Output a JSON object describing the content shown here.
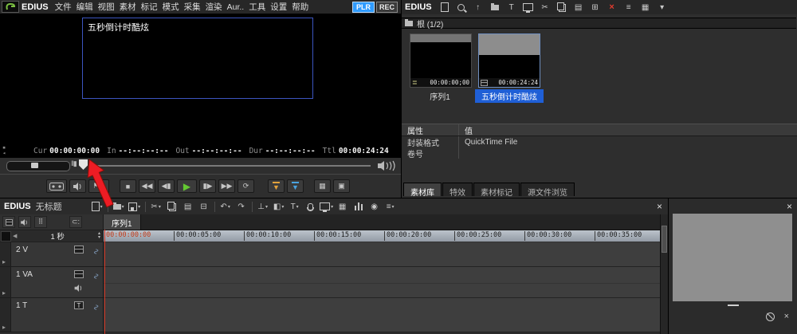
{
  "colors": {
    "selection_blue": "#1f5fd6",
    "plr_blue": "#2f9bff",
    "play_green": "#64c832",
    "red_x": "#e23b2e",
    "annotation_red": "#ed1c24",
    "ruler_bg": "#a8b0ba",
    "playhead_red": "#d0301d"
  },
  "preview": {
    "brand": "EDIUS",
    "menu": [
      "文件",
      "编辑",
      "视图",
      "素材",
      "标记",
      "模式",
      "采集",
      "渲染",
      "Aur..",
      "工具",
      "设置",
      "帮助"
    ],
    "plr_label": "PLR",
    "rec_label": "REC",
    "overlay_text": "五秒倒计时酷炫",
    "timecode": {
      "cur_label": "Cur",
      "cur_value": "00:00:00:00",
      "in_label": "In",
      "in_value": "--:--:--:--",
      "out_label": "Out",
      "out_value": "--:--:--:--",
      "dur_label": "Dur",
      "dur_value": "--:--:--:--",
      "ttl_label": "Ttl",
      "ttl_value": "00:00:24:24"
    }
  },
  "bin": {
    "brand": "EDIUS",
    "path_label": "根 (1/2)",
    "clips": [
      {
        "name": "序列1",
        "timecode": "00:00:00;00"
      },
      {
        "name": "五秒倒计时酷炫",
        "timecode": "00:00:24:24"
      }
    ],
    "properties": {
      "header_attr": "属性",
      "header_value": "值",
      "rows": [
        {
          "attr": "封装格式",
          "value": "QuickTime File"
        },
        {
          "attr": "卷号",
          "value": ""
        }
      ]
    },
    "tabs": [
      "素材库",
      "特效",
      "素材标记",
      "源文件浏览"
    ]
  },
  "timeline": {
    "brand": "EDIUS",
    "title": "无标题",
    "sequence_tab": "序列1",
    "scale_label": "1 秒",
    "ruler_start": "00:00:00:00",
    "ruler_ticks": [
      "00:00:05:00",
      "00:00:10:00",
      "00:00:15:00",
      "00:00:20:00",
      "00:00:25:00",
      "00:00:30:00",
      "00:00:35:00"
    ],
    "tracks": [
      {
        "label": "2 V"
      },
      {
        "label": "1 VA"
      },
      {
        "label": "1 T"
      }
    ]
  }
}
